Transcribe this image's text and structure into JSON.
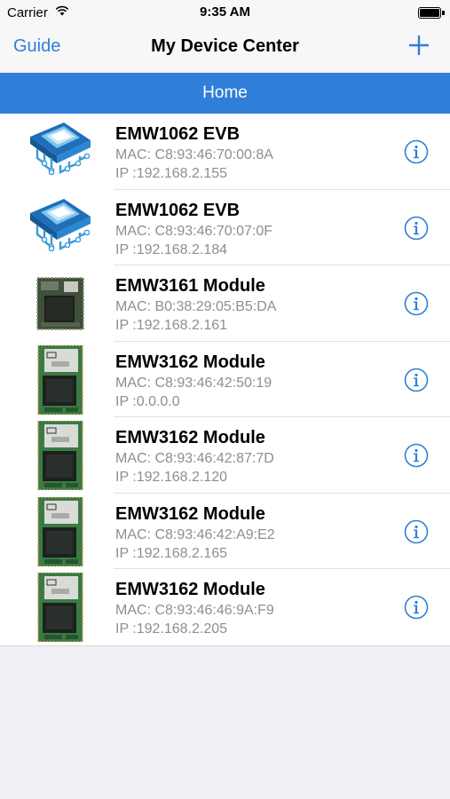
{
  "status_bar": {
    "carrier": "Carrier",
    "time": "9:35 AM"
  },
  "nav": {
    "left_label": "Guide",
    "title": "My Device Center",
    "right_icon": "plus-icon"
  },
  "section": {
    "label": "Home"
  },
  "colors": {
    "accent": "#2f7fd8",
    "subtext": "#8e8e8e",
    "background": "#efeff4"
  },
  "devices": [
    {
      "name": "EMW1062 EVB",
      "mac": "MAC: C8:93:46:70:00:8A",
      "ip": "IP :192.168.2.155",
      "image": "chip-board-icon"
    },
    {
      "name": "EMW1062 EVB",
      "mac": "MAC: C8:93:46:70:07:0F",
      "ip": "IP :192.168.2.184",
      "image": "chip-board-icon"
    },
    {
      "name": "EMW3161 Module",
      "mac": "MAC: B0:38:29:05:B5:DA",
      "ip": "IP :192.168.2.161",
      "image": "module-3161-image"
    },
    {
      "name": "EMW3162 Module",
      "mac": "MAC: C8:93:46:42:50:19",
      "ip": "IP :0.0.0.0",
      "image": "module-3162-image"
    },
    {
      "name": "EMW3162 Module",
      "mac": "MAC: C8:93:46:42:87:7D",
      "ip": "IP :192.168.2.120",
      "image": "module-3162-image"
    },
    {
      "name": "EMW3162 Module",
      "mac": "MAC: C8:93:46:42:A9:E2",
      "ip": "IP :192.168.2.165",
      "image": "module-3162-image"
    },
    {
      "name": "EMW3162 Module",
      "mac": "MAC: C8:93:46:46:9A:F9",
      "ip": "IP :192.168.2.205",
      "image": "module-3162-image"
    }
  ]
}
